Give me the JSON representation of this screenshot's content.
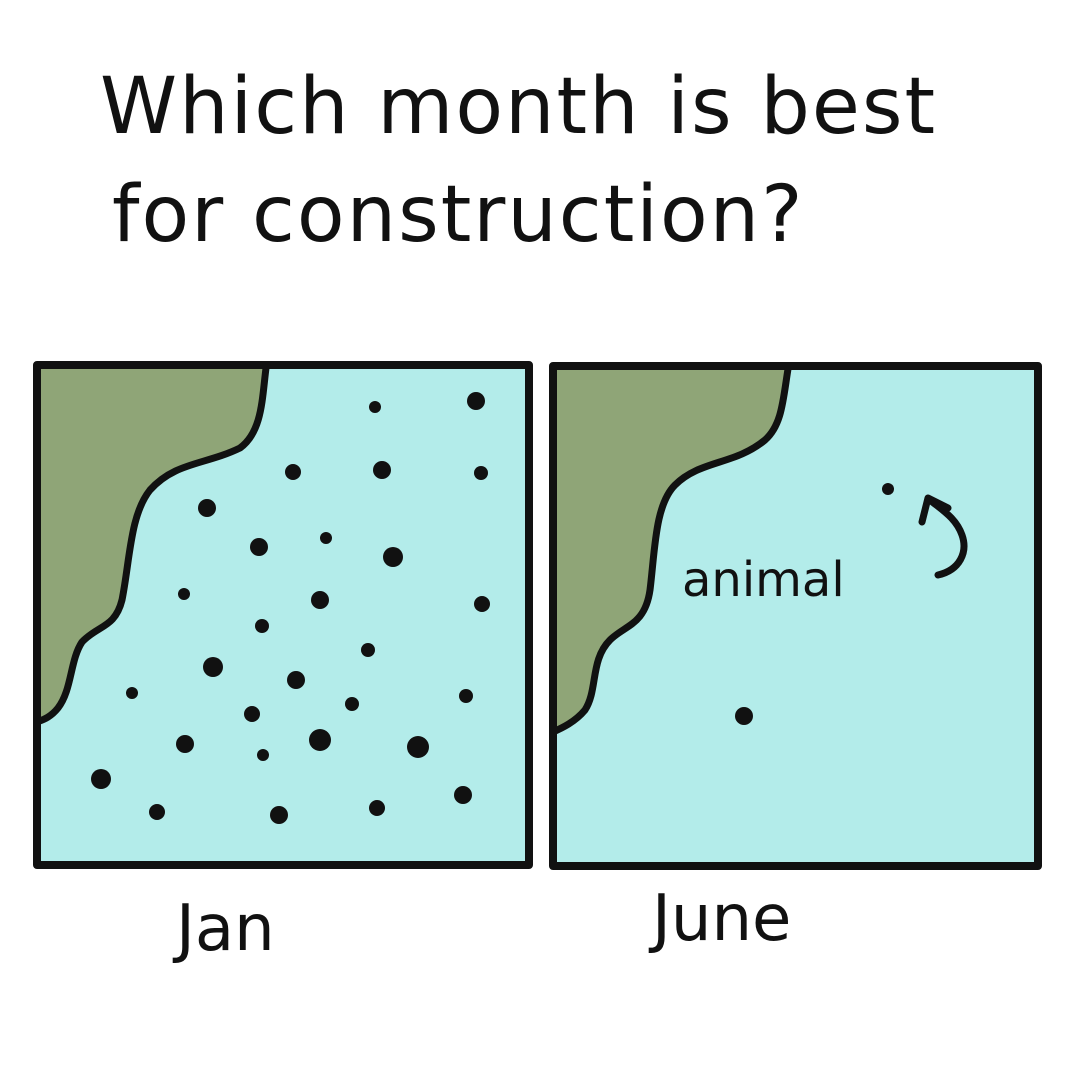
{
  "title": {
    "line1": "Which month is best",
    "line2": "for construction?"
  },
  "panels": [
    {
      "label": "Jan"
    },
    {
      "label": "June",
      "annotation": "animal"
    }
  ],
  "colors": {
    "water": "#b3ecea",
    "land": "#8fa577",
    "ink": "#111111",
    "background": "#ffffff"
  }
}
